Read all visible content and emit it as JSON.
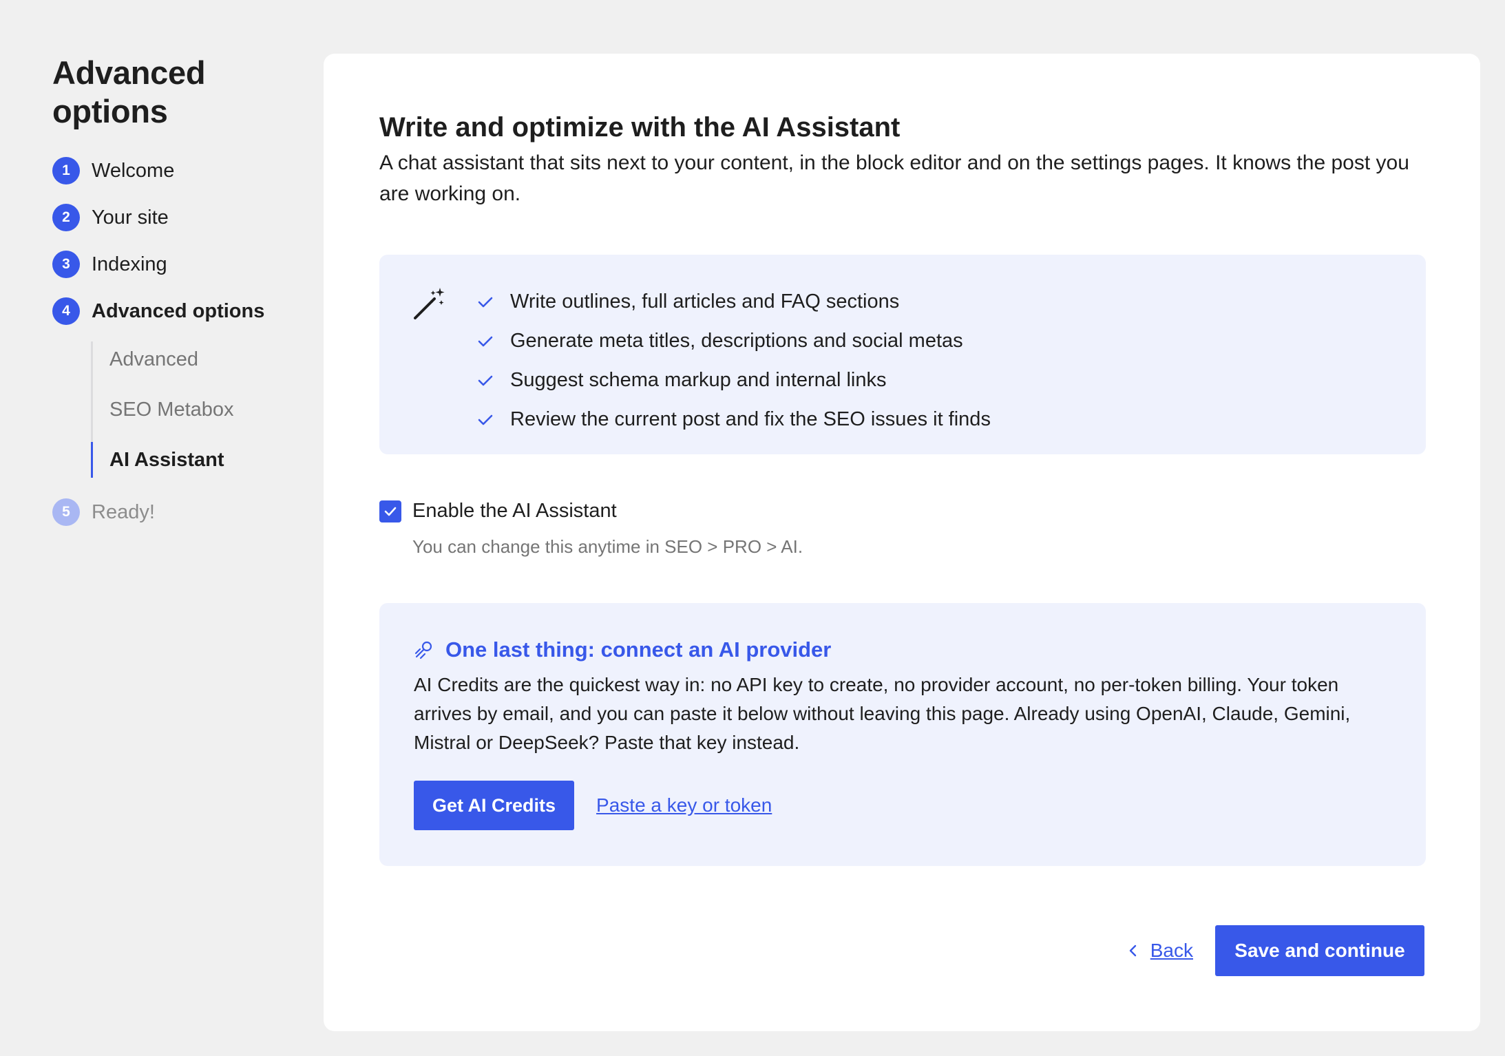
{
  "sidebar": {
    "title": "Advanced options",
    "steps": [
      {
        "num": "1",
        "label": "Welcome"
      },
      {
        "num": "2",
        "label": "Your site"
      },
      {
        "num": "3",
        "label": "Indexing"
      },
      {
        "num": "4",
        "label": "Advanced options"
      },
      {
        "num": "5",
        "label": "Ready!"
      }
    ],
    "substeps": [
      {
        "label": "Advanced"
      },
      {
        "label": "SEO Metabox"
      },
      {
        "label": "AI Assistant"
      }
    ]
  },
  "main": {
    "title": "Write and optimize with the AI Assistant",
    "description": "A chat assistant that sits next to your content, in the block editor and on the settings pages. It knows the post you are working on.",
    "features_icon": "magic-wand-icon",
    "features": [
      "Write outlines, full articles and FAQ sections",
      "Generate meta titles, descriptions and social metas",
      "Suggest schema markup and internal links",
      "Review the current post and fix the SEO issues it finds"
    ],
    "enable": {
      "checked": true,
      "label": "Enable the AI Assistant",
      "help": "You can change this anytime in SEO > PRO > AI."
    },
    "provider": {
      "icon": "plug-icon",
      "title": "One last thing: connect an AI provider",
      "description": "AI Credits are the quickest way in: no API key to create, no provider account, no per-token billing. Your token arrives by email, and you can paste it below without leaving this page. Already using OpenAI, Claude, Gemini, Mistral or DeepSeek? Paste that key instead.",
      "primary_label": "Get AI Credits",
      "link_label": "Paste a key or token"
    },
    "footer": {
      "back_label": "Back",
      "save_label": "Save and continue"
    }
  },
  "colors": {
    "accent": "#3858e9",
    "accent_light": "#a9b7f3",
    "panel_bg": "#eff2fd",
    "page_bg": "#f0f0f0"
  }
}
